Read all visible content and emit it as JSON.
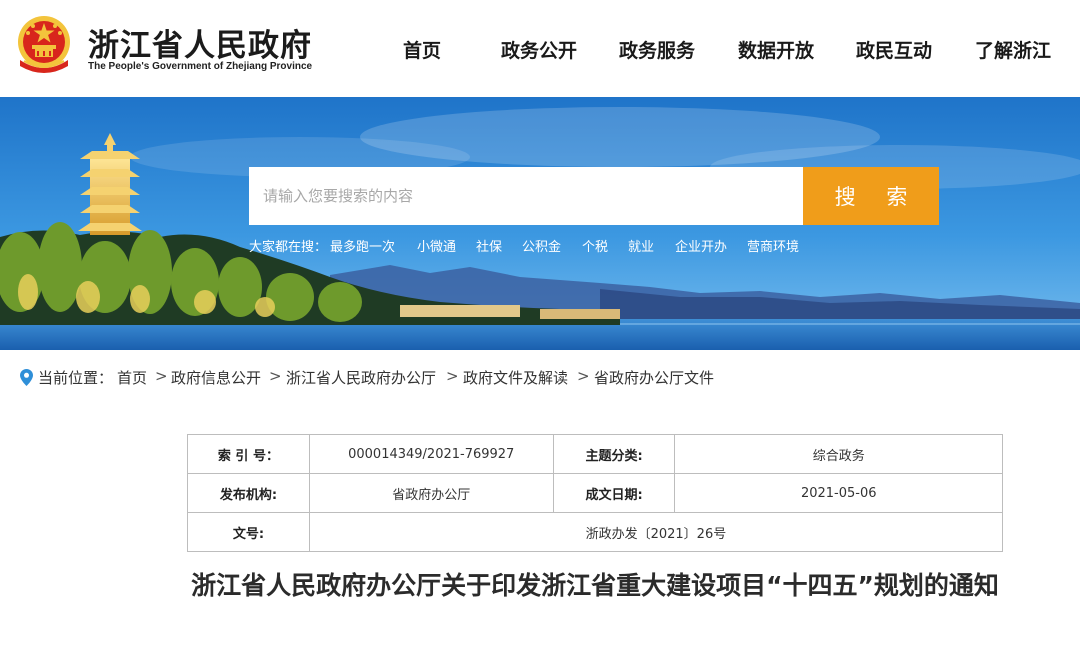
{
  "header": {
    "site_title": "浙江省人民政府",
    "site_subtitle": "The People's Government of Zhejiang Province",
    "emblem_icon": "national-emblem-icon"
  },
  "nav": {
    "items": [
      {
        "label": "首页"
      },
      {
        "label": "政务公开"
      },
      {
        "label": "政务服务"
      },
      {
        "label": "数据开放"
      },
      {
        "label": "政民互动"
      },
      {
        "label": "了解浙江"
      }
    ]
  },
  "search": {
    "placeholder": "请输入您要搜索的内容",
    "value": "",
    "button_label": "搜 索",
    "button_color": "#f09d1a",
    "hot_label": "大家都在搜：",
    "hot_links": [
      "最多跑一次",
      "小微通",
      "社保",
      "公积金",
      "个税",
      "就业",
      "企业开办",
      "营商环境"
    ]
  },
  "breadcrumb": {
    "label": "当前位置：",
    "separator": ">",
    "items": [
      "首页",
      "政府信息公开",
      "浙江省人民政府办公厅",
      "政府文件及解读",
      "省政府办公厅文件"
    ]
  },
  "meta": {
    "index_key": "索 引 号：",
    "index_value": "000014349/2021-769927",
    "topic_key": "主题分类:",
    "topic_value": "综合政务",
    "publisher_key": "发布机构:",
    "publisher_value": "省政府办公厅",
    "date_key": "成文日期:",
    "date_value": "2021-05-06",
    "docno_key": "文号:",
    "docno_value": "浙政办发〔2021〕26号"
  },
  "document": {
    "title": "浙江省人民政府办公厅关于印发浙江省重大建设项目“十四五”规划的通知"
  },
  "colors": {
    "accent": "#f09d1a",
    "pin": "#2f8fd8",
    "emblem_red": "#d8261c",
    "emblem_gold": "#f3c43c"
  }
}
